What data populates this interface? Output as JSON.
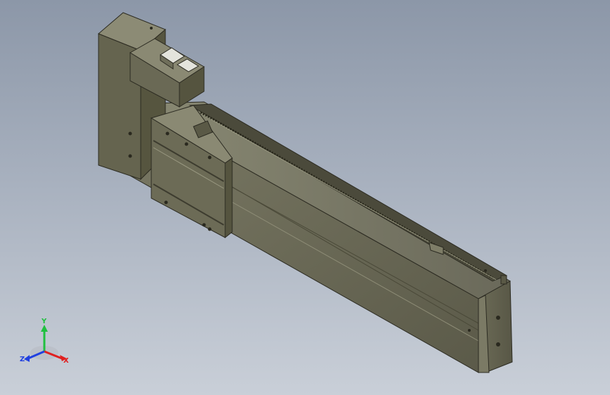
{
  "viewport": {
    "background_top": "#8c97a8",
    "background_bottom": "#c9cfd8"
  },
  "model": {
    "body_color": "#6e6d59",
    "dark_color": "#3c3b30",
    "light_color": "#8b8a73"
  },
  "triad": {
    "x_label": "X",
    "y_label": "Y",
    "z_label": "Z",
    "x_color": "#e02020",
    "y_color": "#20c040",
    "z_color": "#2040e0"
  }
}
